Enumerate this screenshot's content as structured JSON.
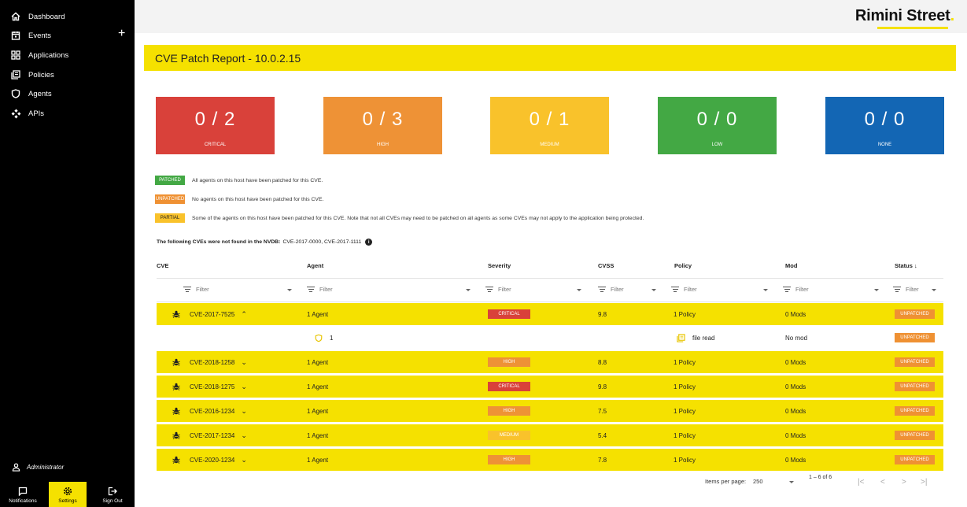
{
  "sidebar": {
    "items": [
      {
        "label": "Dashboard",
        "icon": "home-icon"
      },
      {
        "label": "Events",
        "icon": "calendar-icon"
      },
      {
        "label": "Applications",
        "icon": "grid-icon"
      },
      {
        "label": "Policies",
        "icon": "policy-icon"
      },
      {
        "label": "Agents",
        "icon": "shield-icon"
      },
      {
        "label": "APIs",
        "icon": "api-icon"
      }
    ],
    "add_symbol": "+",
    "user": "Administrator",
    "bottom": {
      "notifications": "Notifications",
      "settings": "Settings",
      "signout": "Sign Out"
    }
  },
  "header": {
    "brand": "Rimini Street",
    "brand_mark": "."
  },
  "page": {
    "title": "CVE Patch Report - 10.0.2.15"
  },
  "summary": [
    {
      "count": "0 / 2",
      "label": "CRITICAL",
      "color": "#d9413a"
    },
    {
      "count": "0 / 3",
      "label": "HIGH",
      "color": "#ee9236"
    },
    {
      "count": "0 / 1",
      "label": "MEDIUM",
      "color": "#f9c22b"
    },
    {
      "count": "0 / 0",
      "label": "LOW",
      "color": "#43a844"
    },
    {
      "count": "0 / 0",
      "label": "NONE",
      "color": "#1366b4"
    }
  ],
  "legend": [
    {
      "badge": "PATCHED",
      "text": "All agents on this host have been patched for this CVE.",
      "color": "#43a844",
      "text_color": "#ffffff"
    },
    {
      "badge": "UNPATCHED",
      "text": "No agents on this host have been patched for this CVE.",
      "color": "#ef9133",
      "text_color": "#ffffff"
    },
    {
      "badge": "PARTIAL",
      "text": "Some of the agents on this host have been patched for this CVE. Note that not all CVEs may need to be patched on all agents as some CVEs may not apply to the application being protected.",
      "color": "#f9c22b",
      "text_color": "#222222"
    }
  ],
  "nvdb": {
    "bold": "The following CVEs were not found in the NVDB:",
    "list": "CVE-2017-0000, CVE-2017-1111",
    "info": "i"
  },
  "table": {
    "headers": {
      "cve": "CVE",
      "agent": "Agent",
      "severity": "Severity",
      "cvss": "CVSS",
      "policy": "Policy",
      "mod": "Mod",
      "status": "Status",
      "sort_arrow": "↓"
    },
    "filter_placeholder": "Filter",
    "rows": [
      {
        "cve": "CVE-2017-7525",
        "agent": "1 Agent",
        "severity": "CRITICAL",
        "sev_color": "#d9413a",
        "cvss": "9.8",
        "policy": "1 Policy",
        "mod": "0 Mods",
        "status": "UNPATCHED",
        "expanded": true
      },
      {
        "cve": "CVE-2018-1258",
        "agent": "1 Agent",
        "severity": "HIGH",
        "sev_color": "#ee9236",
        "cvss": "8.8",
        "policy": "1 Policy",
        "mod": "0 Mods",
        "status": "UNPATCHED",
        "expanded": false
      },
      {
        "cve": "CVE-2018-1275",
        "agent": "1 Agent",
        "severity": "CRITICAL",
        "sev_color": "#d9413a",
        "cvss": "9.8",
        "policy": "1 Policy",
        "mod": "0 Mods",
        "status": "UNPATCHED",
        "expanded": false
      },
      {
        "cve": "CVE-2016-1234",
        "agent": "1 Agent",
        "severity": "HIGH",
        "sev_color": "#ee9236",
        "cvss": "7.5",
        "policy": "1 Policy",
        "mod": "0 Mods",
        "status": "UNPATCHED",
        "expanded": false
      },
      {
        "cve": "CVE-2017-1234",
        "agent": "1 Agent",
        "severity": "MEDIUM",
        "sev_color": "#f9c22b",
        "cvss": "5.4",
        "policy": "1 Policy",
        "mod": "0 Mods",
        "status": "UNPATCHED",
        "expanded": false
      },
      {
        "cve": "CVE-2020-1234",
        "agent": "1 Agent",
        "severity": "HIGH",
        "sev_color": "#ee9236",
        "cvss": "7.8",
        "policy": "1 Policy",
        "mod": "0 Mods",
        "status": "UNPATCHED",
        "expanded": false
      }
    ],
    "detail": {
      "agent": "1",
      "policy": "file read",
      "mod": "No mod",
      "status": "UNPATCHED"
    }
  },
  "pagination": {
    "items_label": "Items per page:",
    "per_page": "250",
    "range": "1 – 6 of 6"
  }
}
